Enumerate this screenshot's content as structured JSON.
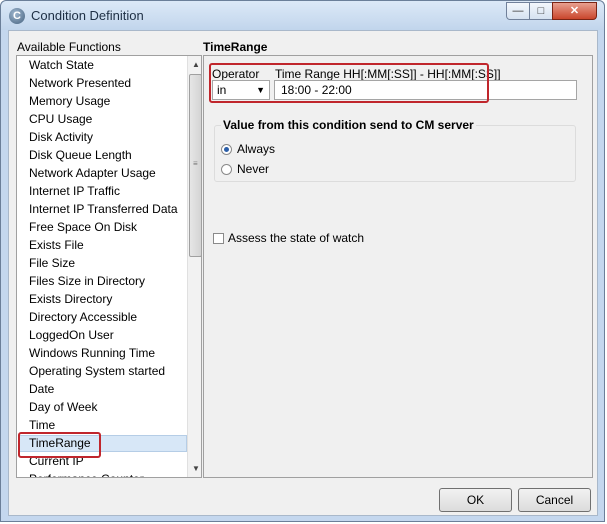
{
  "window": {
    "title": "Condition Definition",
    "app_icon": "C"
  },
  "left": {
    "label": "Available Functions",
    "items": [
      "Watch State",
      "Network Presented",
      "Memory Usage",
      "CPU Usage",
      "Disk Activity",
      "Disk Queue Length",
      "Network Adapter Usage",
      "Internet IP Traffic",
      "Internet IP Transferred Data",
      "Free Space On Disk",
      "Exists File",
      "File Size",
      "Files Size in Directory",
      "Exists Directory",
      "Directory Accessible",
      "LoggedOn User",
      "Windows Running Time",
      "Operating System started",
      "Date",
      "Day of Week",
      "Time",
      "TimeRange",
      "Current IP",
      "Performance Counter"
    ],
    "selected_index": 21
  },
  "right": {
    "title": "TimeRange",
    "operator_label": "Operator",
    "operator_value": "in",
    "timerange_label": "Time Range HH[:MM[:SS]] - HH[:MM[:SS]]",
    "timerange_value": "18:00 - 22:00",
    "group_title": "Value from this condition send to CM server",
    "radio_always": "Always",
    "radio_never": "Never",
    "radio_selected": "Always",
    "assess_label": "Assess the state of watch",
    "assess_checked": false
  },
  "buttons": {
    "ok": "OK",
    "cancel": "Cancel"
  },
  "colors": {
    "highlight": "#c0262c",
    "selection": "#d7e7f7",
    "radio_dot": "#2b5ea8"
  }
}
